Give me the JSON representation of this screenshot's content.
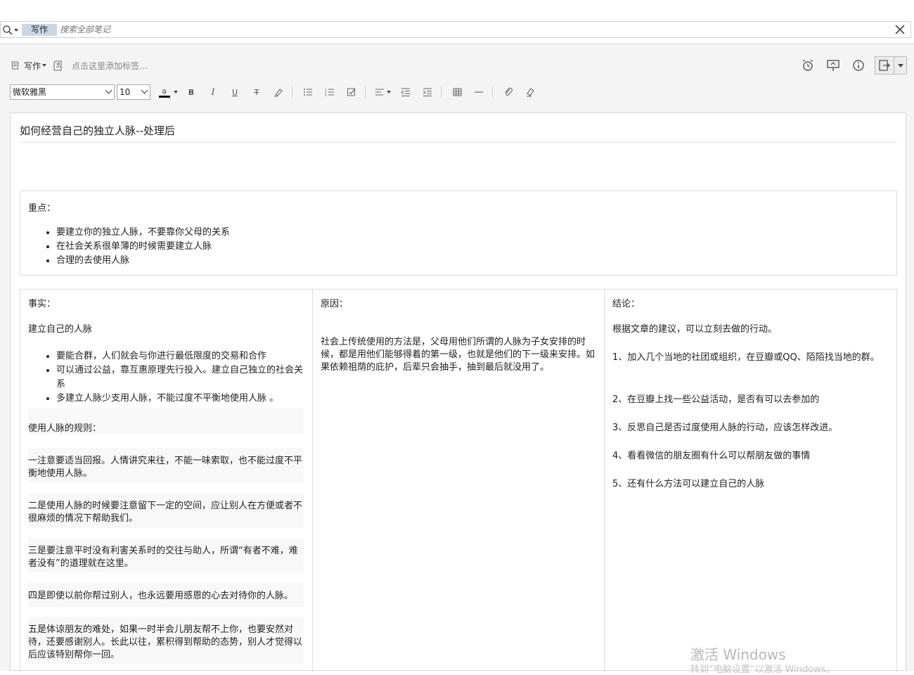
{
  "search": {
    "scope_label": "写作",
    "placeholder": "搜索全部笔记"
  },
  "editor_header": {
    "mode_label": "写作",
    "tag_hint": "点击这里添加标签..."
  },
  "toolbar": {
    "font_family": "微软雅黑",
    "font_size": "10",
    "font_color_glyph": "a",
    "bold": "B",
    "italic": "I",
    "underline": "U",
    "strike": "T"
  },
  "note": {
    "title": "如何经营自己的独立人脉--处理后",
    "key_points": {
      "heading": "重点：",
      "items": [
        "要建立你的独立人脉，不要靠你父母的关系",
        "在社会关系很单薄的时候需要建立人脉",
        "合理的去使用人脉"
      ]
    },
    "facts": {
      "heading": "事实：",
      "subheading": "建立自己的人脉",
      "items": [
        "要能合群，人们就会与你进行最低限度的交易和合作",
        "可以通过公益，靠互惠原理先行投入。建立自己独立的社会关系",
        "多建立人脉少支用人脉，不能过度不平衡地使用人脉 。"
      ],
      "rules_heading": "使用人脉的规则：",
      "rules": [
        "一注意要适当回报。人情讲究来往，不能一味索取，也不能过度不平衡地使用人脉。",
        "二是使用人脉的时候要注意留下一定的空间，应让别人在方便或者不很麻烦的情况下帮助我们。",
        "三是要注意平时没有利害关系时的交往与助人，所谓“有者不难，难者没有”的道理就在这里。",
        "四是即使以前你帮过别人，也永远要用感恩的心去对待你的人脉。",
        "五是体谅朋友的难处，如果一时半会儿朋友帮不上你，也要安然对待，还要感谢别人。长此以往，累积得到帮助的态势，别人才觉得以后应该特别帮你一回。"
      ]
    },
    "reasons": {
      "heading": "原因：",
      "text": "社会上传统使用的方法是，父母用他们所谓的人脉为子女安排的时候，都是用他们能够得着的第一级，也就是他们的下一级来安排。如果依赖祖荫的庇护，后辈只会抽手，抽到最后就没用了。"
    },
    "conclusions": {
      "heading": "结论：",
      "intro": "根据文章的建议，可以立刻去做的行动。",
      "items": [
        "1、加入几个当地的社团或组织，在豆瓣或QQ、陌陌找当地的群。",
        "2、在豆瓣上找一些公益活动，是否有可以去参加的",
        "3、反思自己是否过度使用人脉的行动，应该怎样改进。",
        "4、看看微信的朋友圈有什么可以帮朋友做的事情",
        "5、还有什么方法可以建立自己的人脉"
      ]
    }
  },
  "system": {
    "watermark_line1": "激活 Windows",
    "watermark_line2": "转到“电脑设置”以激活 Windows。"
  }
}
